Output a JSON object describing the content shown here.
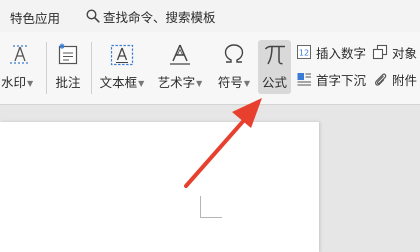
{
  "tabbar": {
    "special_apps": "特色应用",
    "search_text": "查找命令、搜索模板"
  },
  "ribbon": {
    "watermark": "水印",
    "comment": "批注",
    "textbox": "文本框",
    "wordart": "艺术字",
    "symbol": "符号",
    "formula": "公式",
    "insert_number": "插入数字",
    "drop_cap": "首字下沉",
    "object": "对象",
    "attachment": "附件"
  },
  "colors": {
    "arrow": "#e8402f",
    "formula_highlight": "#d9d9d9",
    "icon_blue": "#3a7bd5"
  }
}
